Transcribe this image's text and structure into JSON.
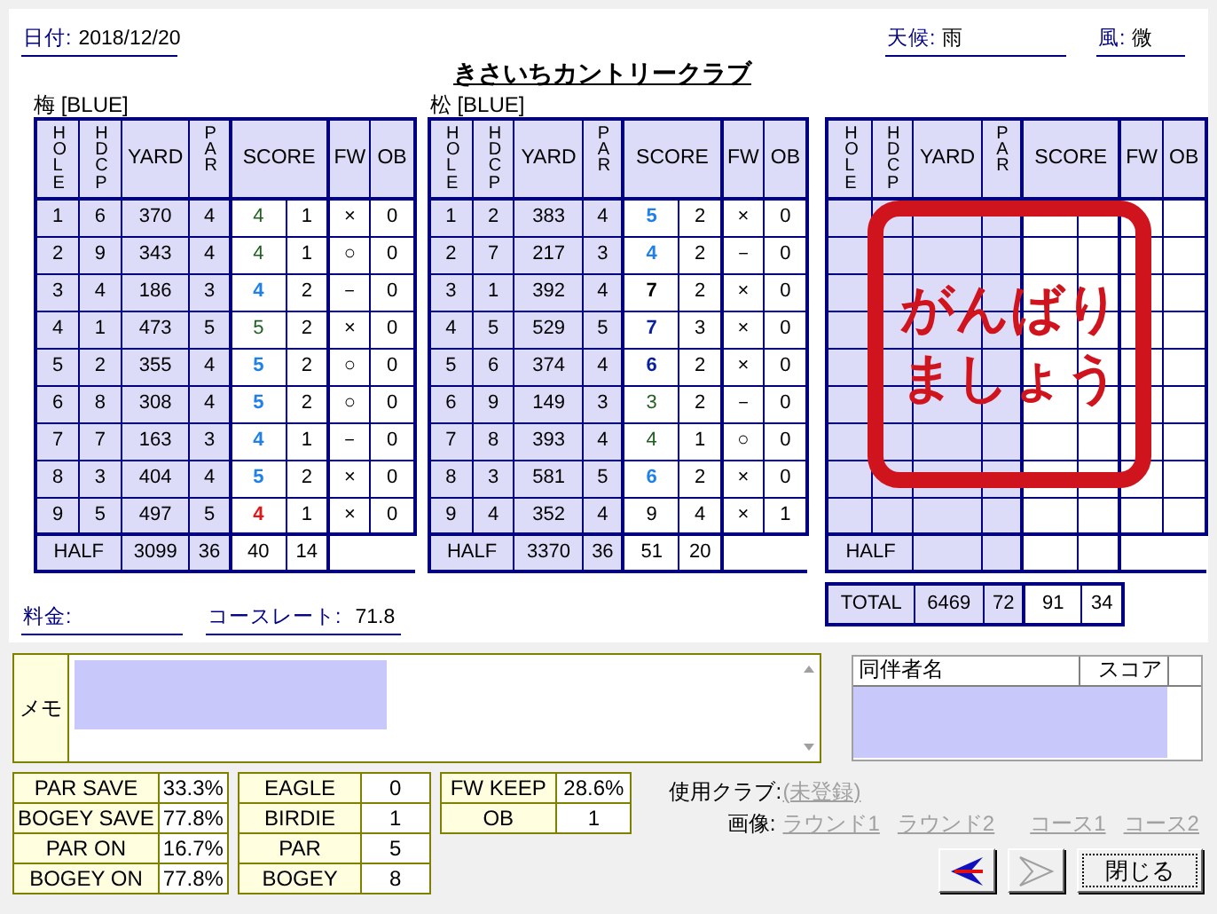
{
  "date": {
    "label": "日付:",
    "value": "2018/12/20"
  },
  "weather": {
    "label": "天候:",
    "value": "雨"
  },
  "wind": {
    "label": "風:",
    "value": "微"
  },
  "course_name": "きさいちカントリークラブ",
  "scorecards": [
    {
      "title": "梅 [BLUE]",
      "columns": [
        {
          "label": "HOLE",
          "vertical": true
        },
        {
          "label": "HDCP",
          "vertical": true
        },
        {
          "label": "YARD",
          "vertical": false
        },
        {
          "label": "PAR",
          "vertical": true
        },
        {
          "label": "SCORE",
          "vertical": false
        },
        {
          "label": "FW",
          "vertical": false
        },
        {
          "label": "OB",
          "vertical": false
        }
      ],
      "holes": [
        {
          "hole": "1",
          "hdcp": "6",
          "yard": "370",
          "par": "4",
          "score": "4",
          "color": "#1f5f1f",
          "bold": false,
          "putts": "1",
          "fw": "×",
          "ob": "0"
        },
        {
          "hole": "2",
          "hdcp": "9",
          "yard": "343",
          "par": "4",
          "score": "4",
          "color": "#1f5f1f",
          "bold": false,
          "putts": "1",
          "fw": "○",
          "ob": "0"
        },
        {
          "hole": "3",
          "hdcp": "4",
          "yard": "186",
          "par": "3",
          "score": "4",
          "color": "#1e80e8",
          "bold": true,
          "putts": "2",
          "fw": "－",
          "ob": "0"
        },
        {
          "hole": "4",
          "hdcp": "1",
          "yard": "473",
          "par": "5",
          "score": "5",
          "color": "#1f5f1f",
          "bold": false,
          "putts": "2",
          "fw": "×",
          "ob": "0"
        },
        {
          "hole": "5",
          "hdcp": "2",
          "yard": "355",
          "par": "4",
          "score": "5",
          "color": "#1e80e8",
          "bold": true,
          "putts": "2",
          "fw": "○",
          "ob": "0"
        },
        {
          "hole": "6",
          "hdcp": "8",
          "yard": "308",
          "par": "4",
          "score": "5",
          "color": "#1e80e8",
          "bold": true,
          "putts": "2",
          "fw": "○",
          "ob": "0"
        },
        {
          "hole": "7",
          "hdcp": "7",
          "yard": "163",
          "par": "3",
          "score": "4",
          "color": "#1e80e8",
          "bold": true,
          "putts": "1",
          "fw": "－",
          "ob": "0"
        },
        {
          "hole": "8",
          "hdcp": "3",
          "yard": "404",
          "par": "4",
          "score": "5",
          "color": "#1e80e8",
          "bold": true,
          "putts": "2",
          "fw": "×",
          "ob": "0"
        },
        {
          "hole": "9",
          "hdcp": "5",
          "yard": "497",
          "par": "5",
          "score": "4",
          "color": "#e01818",
          "bold": true,
          "putts": "1",
          "fw": "×",
          "ob": "0"
        }
      ],
      "half": {
        "label": "HALF",
        "yard": "3099",
        "par": "36",
        "score": "40",
        "putts": "14"
      }
    },
    {
      "title": "松 [BLUE]",
      "columns": [
        {
          "label": "HOLE",
          "vertical": true
        },
        {
          "label": "HDCP",
          "vertical": true
        },
        {
          "label": "YARD",
          "vertical": false
        },
        {
          "label": "PAR",
          "vertical": true
        },
        {
          "label": "SCORE",
          "vertical": false
        },
        {
          "label": "FW",
          "vertical": false
        },
        {
          "label": "OB",
          "vertical": false
        }
      ],
      "holes": [
        {
          "hole": "1",
          "hdcp": "2",
          "yard": "383",
          "par": "4",
          "score": "5",
          "color": "#1e80e8",
          "bold": true,
          "putts": "2",
          "fw": "×",
          "ob": "0"
        },
        {
          "hole": "2",
          "hdcp": "7",
          "yard": "217",
          "par": "3",
          "score": "4",
          "color": "#1e80e8",
          "bold": true,
          "putts": "2",
          "fw": "－",
          "ob": "0"
        },
        {
          "hole": "3",
          "hdcp": "1",
          "yard": "392",
          "par": "4",
          "score": "7",
          "color": "#000000",
          "bold": true,
          "putts": "2",
          "fw": "×",
          "ob": "0"
        },
        {
          "hole": "4",
          "hdcp": "5",
          "yard": "529",
          "par": "5",
          "score": "7",
          "color": "#0a1fa0",
          "bold": true,
          "putts": "3",
          "fw": "×",
          "ob": "0"
        },
        {
          "hole": "5",
          "hdcp": "6",
          "yard": "374",
          "par": "4",
          "score": "6",
          "color": "#0a1fa0",
          "bold": true,
          "putts": "2",
          "fw": "×",
          "ob": "0"
        },
        {
          "hole": "6",
          "hdcp": "9",
          "yard": "149",
          "par": "3",
          "score": "3",
          "color": "#1f5f1f",
          "bold": false,
          "putts": "2",
          "fw": "－",
          "ob": "0"
        },
        {
          "hole": "7",
          "hdcp": "8",
          "yard": "393",
          "par": "4",
          "score": "4",
          "color": "#1f5f1f",
          "bold": false,
          "putts": "1",
          "fw": "○",
          "ob": "0"
        },
        {
          "hole": "8",
          "hdcp": "3",
          "yard": "581",
          "par": "5",
          "score": "6",
          "color": "#1e80e8",
          "bold": true,
          "putts": "2",
          "fw": "×",
          "ob": "0"
        },
        {
          "hole": "9",
          "hdcp": "4",
          "yard": "352",
          "par": "4",
          "score": "9",
          "color": "#000000",
          "bold": false,
          "putts": "4",
          "fw": "×",
          "ob": "1"
        }
      ],
      "half": {
        "label": "HALF",
        "yard": "3370",
        "par": "36",
        "score": "51",
        "putts": "20"
      }
    },
    {
      "columns": [
        {
          "label": "HOLE",
          "vertical": true
        },
        {
          "label": "HDCP",
          "vertical": true
        },
        {
          "label": "YARD",
          "vertical": false
        },
        {
          "label": "PAR",
          "vertical": true
        },
        {
          "label": "SCORE",
          "vertical": false
        },
        {
          "label": "FW",
          "vertical": false
        },
        {
          "label": "OB",
          "vertical": false
        }
      ],
      "half": {
        "label": "HALF"
      },
      "stamp": {
        "lines": [
          "がんばり",
          "ましょう"
        ]
      }
    }
  ],
  "total": {
    "label": "TOTAL",
    "yard": "6469",
    "par": "72",
    "score": "91",
    "putts": "34"
  },
  "fee": {
    "label": "料金:"
  },
  "course_rate": {
    "label": "コースレート:",
    "value": "71.8"
  },
  "memo": {
    "label": "メモ"
  },
  "companions": {
    "columns": [
      "同伴者名",
      "スコア"
    ]
  },
  "stats": [
    [
      {
        "label": "PAR SAVE",
        "value": "33.3%"
      },
      {
        "label": "BOGEY SAVE",
        "value": "77.8%"
      },
      {
        "label": "PAR ON",
        "value": "16.7%"
      },
      {
        "label": "BOGEY ON",
        "value": "77.8%"
      }
    ],
    [
      {
        "label": "EAGLE",
        "value": "0"
      },
      {
        "label": "BIRDIE",
        "value": "1"
      },
      {
        "label": "PAR",
        "value": "5"
      },
      {
        "label": "BOGEY",
        "value": "8"
      }
    ],
    [
      {
        "label": "FW KEEP",
        "value": "28.6%"
      },
      {
        "label": "OB",
        "value": "1"
      }
    ]
  ],
  "clubs": {
    "label": "使用クラブ:",
    "links": [
      {
        "text": "(未登録)",
        "disabled": true
      }
    ]
  },
  "images": {
    "label": "画像:",
    "links": [
      {
        "text": "ラウンド1",
        "disabled": true
      },
      {
        "text": "ラウンド2",
        "disabled": true
      },
      {
        "text": "コース1",
        "disabled": true
      },
      {
        "text": "コース2",
        "disabled": true
      }
    ]
  },
  "buttons": [
    {
      "kind": "back",
      "disabled": false
    },
    {
      "kind": "forward",
      "disabled": true
    },
    {
      "kind": "text",
      "label": "閉じる",
      "disabled": false
    }
  ]
}
